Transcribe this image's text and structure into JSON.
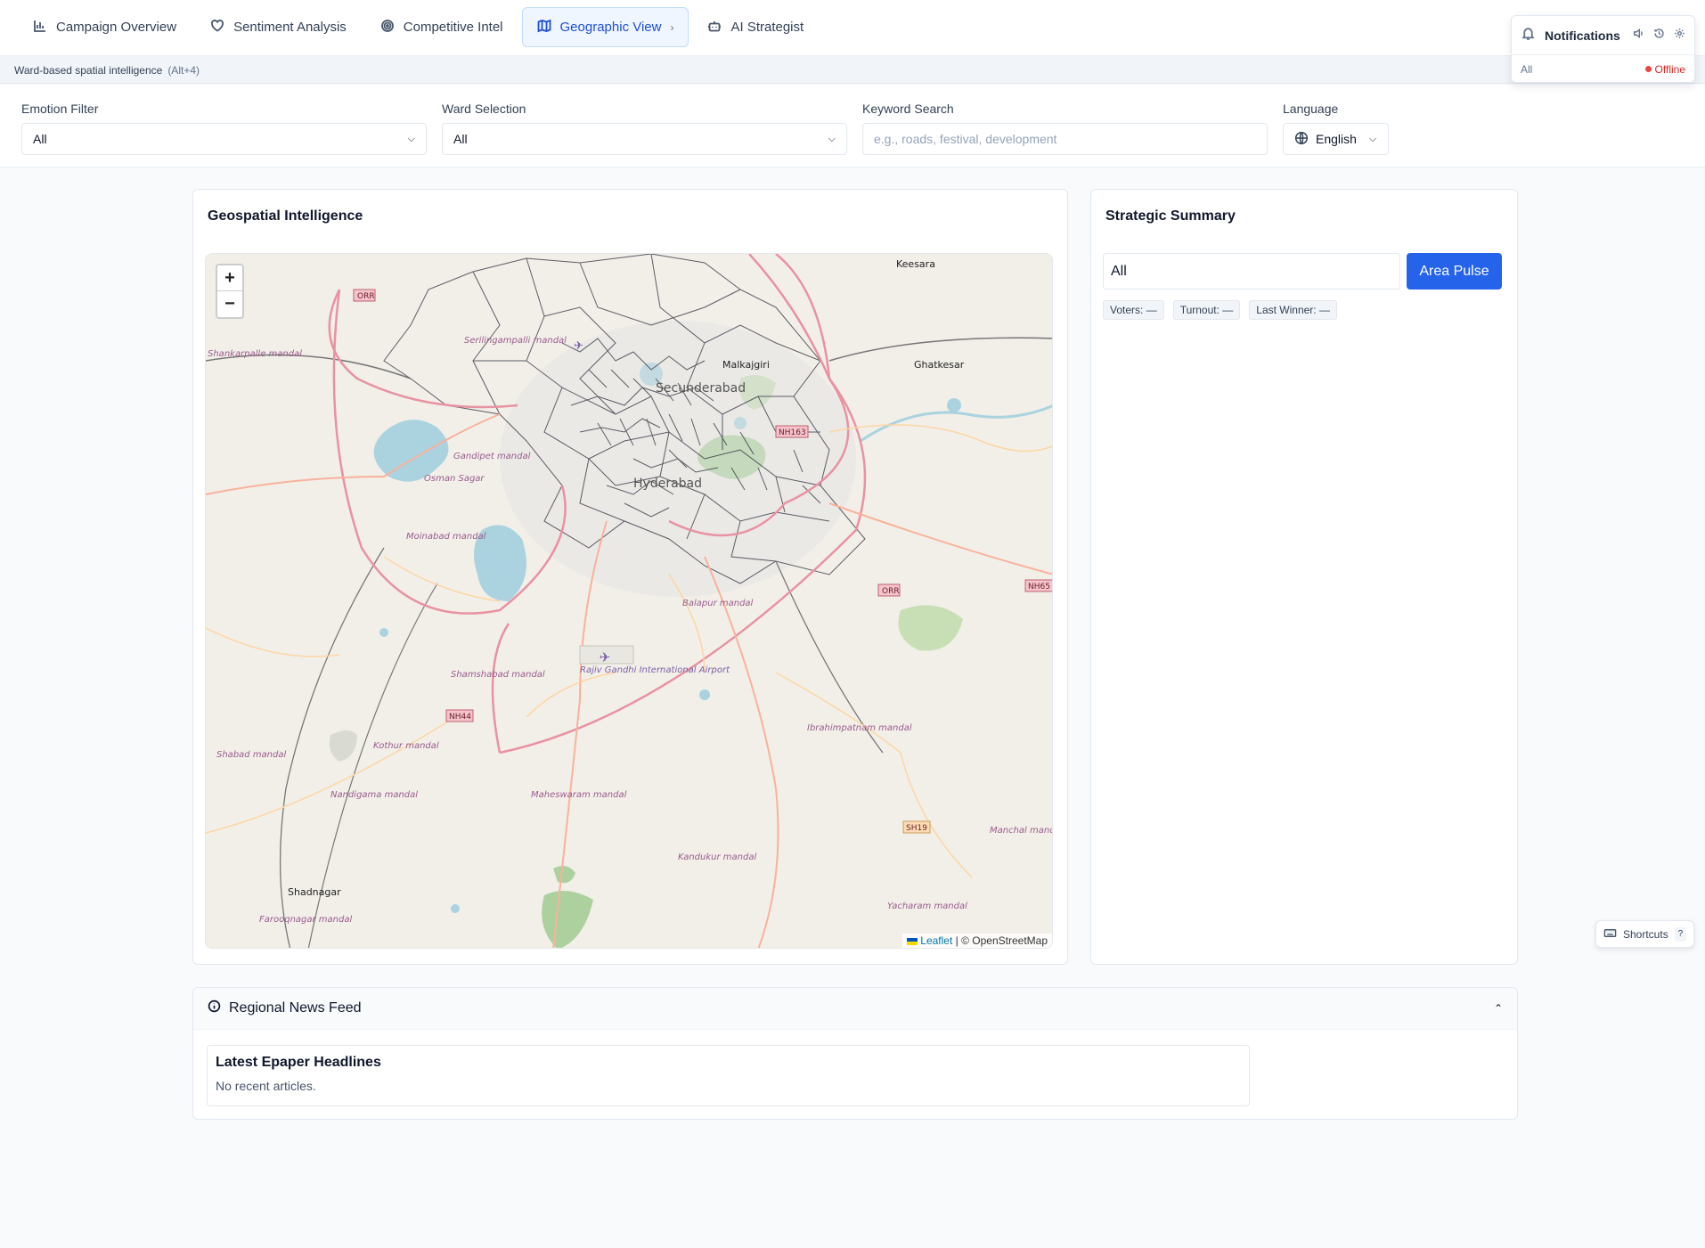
{
  "nav": {
    "tabs": [
      {
        "label": "Campaign Overview",
        "icon": "bar-chart-icon"
      },
      {
        "label": "Sentiment Analysis",
        "icon": "heart-icon"
      },
      {
        "label": "Competitive Intel",
        "icon": "target-icon"
      },
      {
        "label": "Geographic View",
        "icon": "map-icon",
        "active": true
      },
      {
        "label": "AI Strategist",
        "icon": "bot-icon"
      }
    ],
    "active_chevron": "›"
  },
  "subbar": {
    "text": "Ward-based spatial intelligence",
    "hint": "(Alt+4)"
  },
  "notifications": {
    "title": "Notifications",
    "filter": "All",
    "status": "Offline",
    "status_color": "#ef4444",
    "icons": [
      "volume-icon",
      "history-icon",
      "settings-icon"
    ]
  },
  "filters": {
    "emotion": {
      "label": "Emotion Filter",
      "value": "All"
    },
    "ward": {
      "label": "Ward Selection",
      "value": "All"
    },
    "keyword": {
      "label": "Keyword Search",
      "placeholder": "e.g., roads, festival, development"
    },
    "language": {
      "label": "Language",
      "value": "English"
    }
  },
  "geo": {
    "title": "Geospatial Intelligence",
    "zoom_in": "+",
    "zoom_out": "−",
    "attribution_leaflet": "Leaflet",
    "attribution_rest": "| © OpenStreetMap",
    "places": {
      "keesara": "Keesara",
      "ghatkesar": "Ghatkesar",
      "malkajgiri": "Malkajgiri",
      "secunderabad": "Secunderabad",
      "hyderabad": "Hyderabad",
      "shankarpalle": "Shankarpalle mandal",
      "serilingampalli": "Serilingampalli mandal",
      "gandipet": "Gandipet mandal",
      "osman_sagar": "Osman Sagar",
      "moinabad": "Moinabad mandal",
      "balapur": "Balapur mandal",
      "shamshabad": "Shamshabad mandal",
      "airport": "Rajiv Gandhi International Airport",
      "ibrahimpatnam": "Ibrahimpatnam mandal",
      "kothur": "Kothur mandal",
      "shabad": "Shabad mandal",
      "nandigama": "Nandigama mandal",
      "maheswaram": "Maheswaram mandal",
      "kandukur": "Kandukur mandal",
      "shadnagar": "Shadnagar",
      "farooqnagar": "Farooqnagar mandal",
      "yacharam": "Yacharam mandal",
      "manchal": "Manchal mandal"
    },
    "road_shields": {
      "orr": "ORR",
      "nh44": "NH44",
      "nh163": "NH163",
      "nh65": "NH65",
      "sh19": "SH19"
    }
  },
  "summary": {
    "title": "Strategic Summary",
    "ward_value": "All",
    "button": "Area Pulse",
    "chips": [
      "Voters: —",
      "Turnout: —",
      "Last Winner: —"
    ]
  },
  "news": {
    "title": "Regional News Feed",
    "headlines_title": "Latest Epaper Headlines",
    "empty": "No recent articles."
  },
  "shortcuts": {
    "label": "Shortcuts",
    "key": "?"
  },
  "colors": {
    "accent": "#2563eb",
    "active_tab_bg": "#eff6ff",
    "offline": "#dc2626"
  }
}
